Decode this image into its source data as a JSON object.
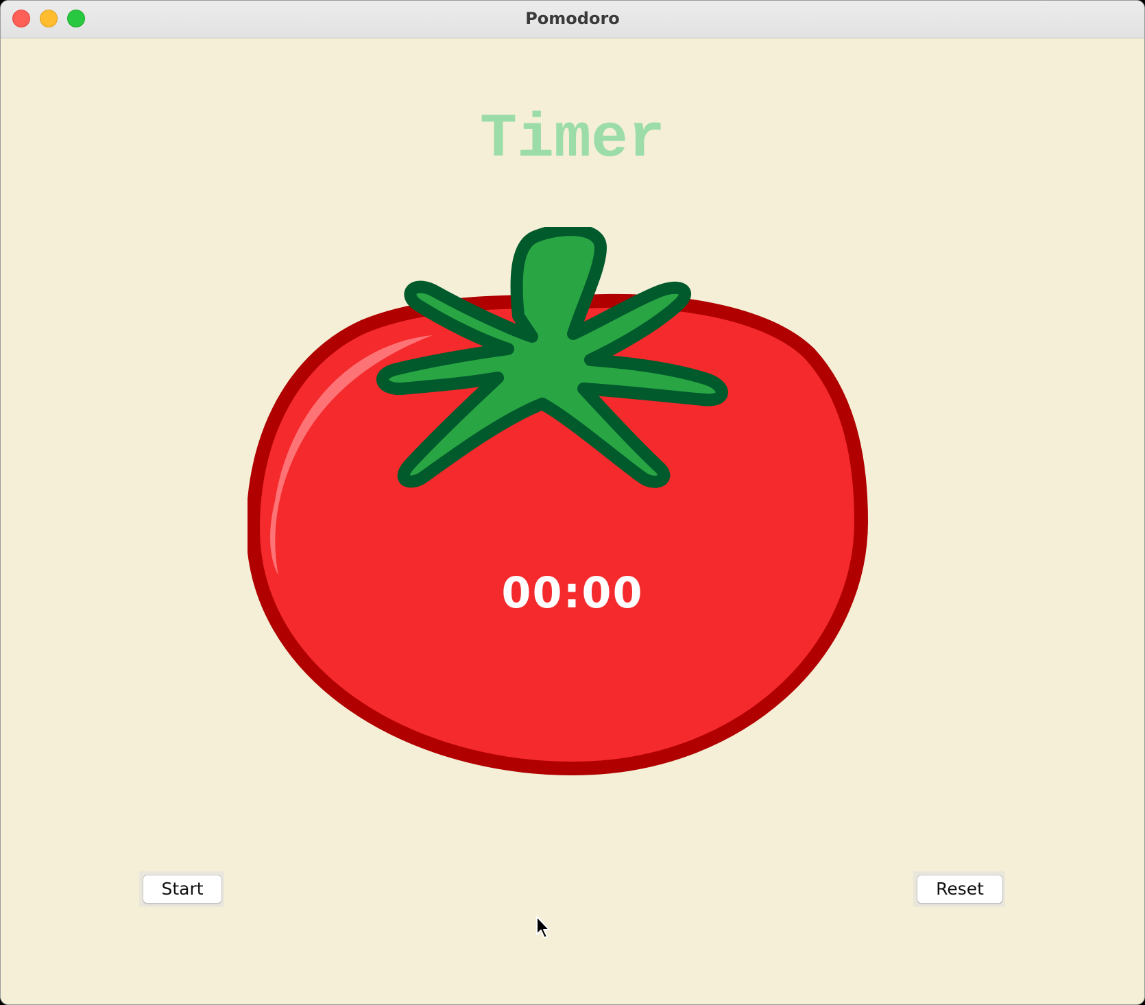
{
  "window": {
    "title": "Pomodoro"
  },
  "heading": "Timer",
  "timer": {
    "display": "00:00"
  },
  "buttons": {
    "start_label": "Start",
    "reset_label": "Reset"
  },
  "colors": {
    "background": "#f4efd6",
    "heading": "#9bdca9",
    "tomato_fill": "#f42a2c",
    "tomato_outline": "#b00000",
    "stem_fill": "#2aa544",
    "stem_outline": "#005a2c",
    "countdown_text": "#ffffff"
  },
  "icons": {
    "close": "close-icon",
    "minimize": "minimize-icon",
    "maximize": "maximize-icon",
    "tomato": "tomato-icon",
    "cursor": "pointer-cursor-icon"
  }
}
